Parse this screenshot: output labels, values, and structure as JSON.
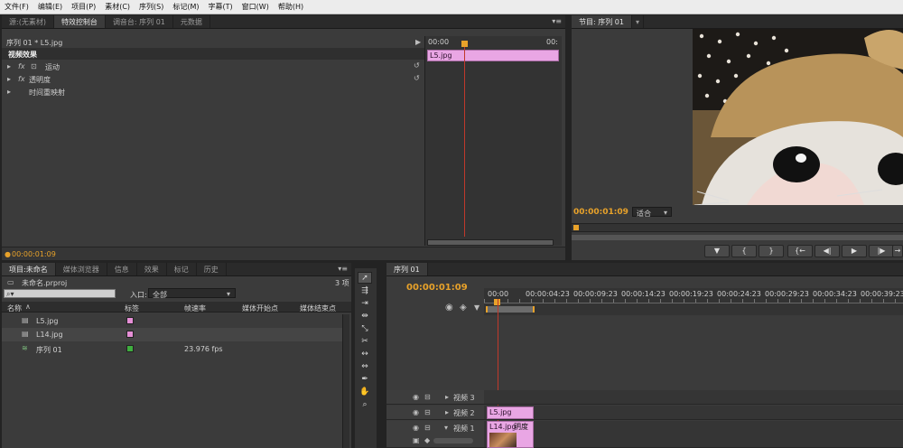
{
  "menu": [
    "文件(F)",
    "编辑(E)",
    "项目(P)",
    "素材(C)",
    "序列(S)",
    "标记(M)",
    "字幕(T)",
    "窗口(W)",
    "帮助(H)"
  ],
  "effect_controls": {
    "tabs": [
      "源:(无素材)",
      "特效控制台",
      "调音台: 序列 01",
      "元数据"
    ],
    "clip_name": "序列 01 * L5.jpg",
    "video_effects_header": "视频效果",
    "effects": [
      "运动",
      "透明度",
      "时间重映射"
    ],
    "timecode_start": "00:00",
    "timecode_end": "00:",
    "clip_label": "L5.jpg",
    "current_time": "00:00:01:09"
  },
  "program": {
    "tab": "节目: 序列 01",
    "timecode": "00:00:01:09",
    "fit_label": "适合",
    "buttons": [
      "▼",
      "{",
      "}",
      "{←",
      "◀|",
      "▶",
      "|▶",
      "→"
    ]
  },
  "project": {
    "tabs": [
      "项目:未命名",
      "媒体浏览器",
      "信息",
      "效果",
      "标记",
      "历史"
    ],
    "file_name": "未命名.prproj",
    "item_count": "3 项",
    "entry_label": "入口:",
    "entry_value": "全部",
    "columns": [
      "名称",
      "标签",
      "帧速率",
      "媒体开始点",
      "媒体结束点"
    ],
    "rows": [
      {
        "name": "L5.jpg",
        "color": "#e58fd6",
        "fps": ""
      },
      {
        "name": "L14.jpg",
        "color": "#e58fd6",
        "fps": ""
      },
      {
        "name": "序列 01",
        "color": "#3fae3f",
        "fps": "23.976 fps"
      }
    ]
  },
  "timeline": {
    "tab": "序列 01",
    "timecode": "00:00:01:09",
    "ruler": [
      "00:00",
      "00:00:04:23",
      "00:00:09:23",
      "00:00:14:23",
      "00:00:19:23",
      "00:00:24:23",
      "00:00:29:23",
      "00:00:34:23",
      "00:00:39:23"
    ],
    "tracks": [
      "视频 3",
      "视频 2",
      "视频 1"
    ],
    "clip_v2": "L5.jpg",
    "clip_v1": "L14.jpg",
    "clip_v1_effect": "明度"
  },
  "colors": {
    "accent": "#e8a22a",
    "clip": "#e9a6e4",
    "playhead": "#c0392b"
  }
}
